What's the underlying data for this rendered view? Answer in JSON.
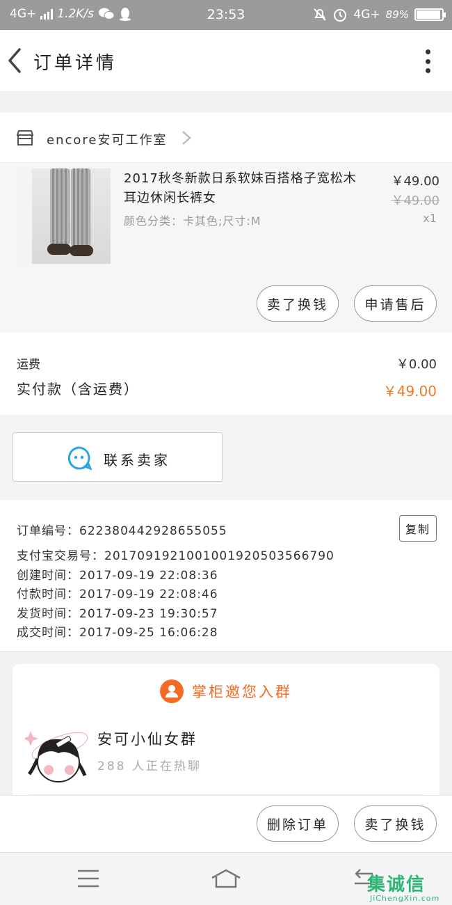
{
  "status_bar": {
    "network": "4G+",
    "speed": "1.2K/s",
    "time": "23:53",
    "network_right": "4G+",
    "battery": "89%",
    "battery_level": 0.89
  },
  "header": {
    "title": "订单详情"
  },
  "shop": {
    "name": "encore安可工作室"
  },
  "product": {
    "title": "2017秋冬新款日系软妹百搭格子宽松木耳边休闲长裤女",
    "spec": "颜色分类：卡其色;尺寸:M",
    "price": "￥49.00",
    "original_price": "￥49.00",
    "quantity": "x1",
    "btn_sell_exchange": "卖了换钱",
    "btn_after_sale": "申请售后"
  },
  "fees": {
    "shipping_label": "运费",
    "shipping_value": "￥0.00",
    "total_label": "实付款（含运费）",
    "total_value": "￥49.00"
  },
  "contact": {
    "label": "联系卖家"
  },
  "order_info": {
    "order_no": "订单编号：622380442928655055",
    "alipay_no": "支付宝交易号：2017091921001001920503566790",
    "created": "创建时间：2017-09-19  22:08:36",
    "paid": "付款时间：2017-09-19  22:08:46",
    "shipped": "发货时间：2017-09-23  19:30:57",
    "completed": "成交时间：2017-09-25  16:06:28",
    "copy_label": "复制"
  },
  "group": {
    "heading": "掌柜邀您入群",
    "name": "安可小仙女群",
    "count": "288 人正在热聊"
  },
  "footer": {
    "delete_label": "删除订单",
    "sell_label": "卖了换钱"
  },
  "watermark": {
    "brand": "集诚信",
    "site": "JiChengXin.com"
  },
  "colors": {
    "accent": "#f07a24",
    "contact_icon": "#2aa7df",
    "status_bar": "#9b9b9b"
  }
}
